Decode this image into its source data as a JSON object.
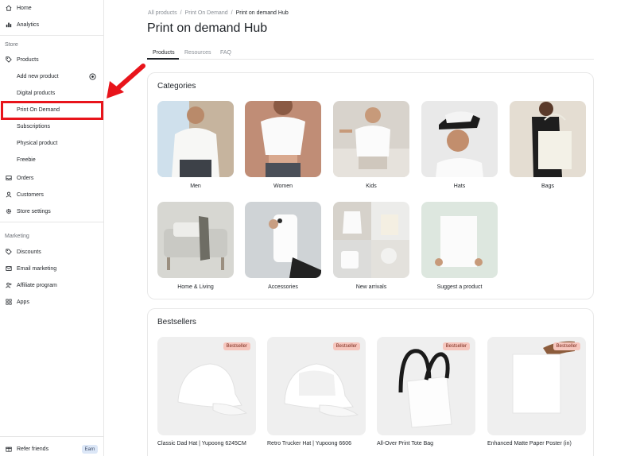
{
  "sidebar": {
    "items_top": [
      {
        "label": "Home",
        "icon": "home-icon"
      },
      {
        "label": "Analytics",
        "icon": "bar-chart-icon"
      }
    ],
    "store_label": "Store",
    "store_items": [
      {
        "label": "Products",
        "icon": "tag-icon"
      },
      {
        "label": "Add new product"
      },
      {
        "label": "Digital products"
      },
      {
        "label": "Print On Demand"
      },
      {
        "label": "Subscriptions"
      },
      {
        "label": "Physical product"
      },
      {
        "label": "Freebie"
      },
      {
        "label": "Orders",
        "icon": "inbox-icon"
      },
      {
        "label": "Customers",
        "icon": "user-icon"
      },
      {
        "label": "Store settings",
        "icon": "gear-icon"
      }
    ],
    "marketing_label": "Marketing",
    "marketing_items": [
      {
        "label": "Discounts",
        "icon": "discount-tag-icon"
      },
      {
        "label": "Email marketing",
        "icon": "mail-icon"
      },
      {
        "label": "Affiliate program",
        "icon": "user-plus-icon"
      },
      {
        "label": "Apps",
        "icon": "grid-icon"
      }
    ],
    "refer": {
      "label": "Refer friends",
      "badge": "Earn"
    },
    "highlight_color": "#e8141b"
  },
  "breadcrumb": [
    "All products",
    "Print On Demand",
    "Print on demand Hub"
  ],
  "page_title": "Print on demand Hub",
  "tabs": [
    "Products",
    "Resources",
    "FAQ"
  ],
  "categories": {
    "title": "Categories",
    "items": [
      "Men",
      "Women",
      "Kids",
      "Hats",
      "Bags",
      "Home & Living",
      "Accessories",
      "New arrivals",
      "Suggest a product"
    ]
  },
  "bestsellers": {
    "title": "Bestsellers",
    "badge": "Bestseller",
    "items": [
      "Classic Dad Hat | Yupoong 6245CM",
      "Retro Trucker Hat | Yupoong 6606",
      "All-Over Print Tote Bag",
      "Enhanced Matte Paper Poster (in)"
    ]
  }
}
